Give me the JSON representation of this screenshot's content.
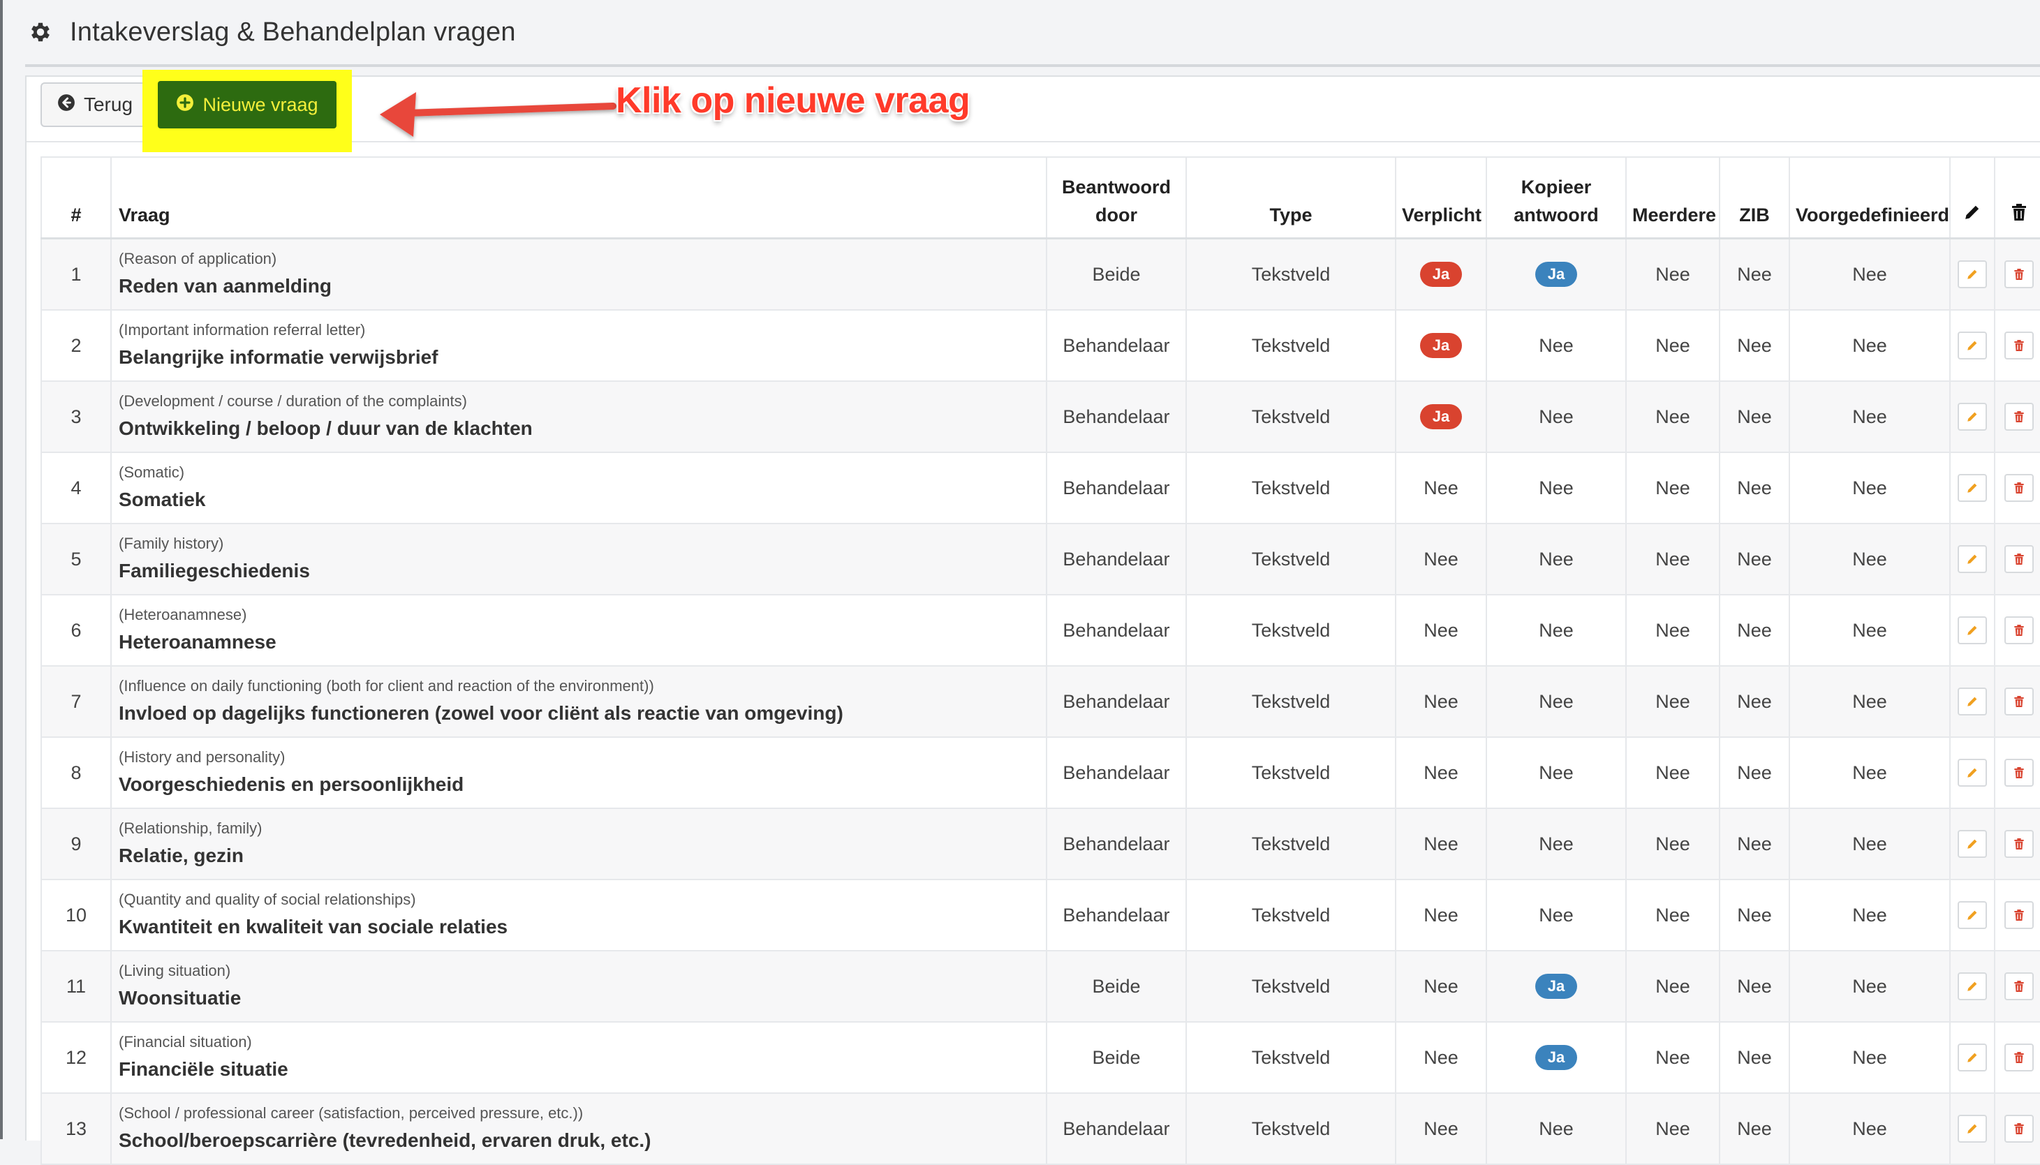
{
  "page": {
    "title": "Intakeverslag & Behandelplan vragen"
  },
  "toolbar": {
    "back_label": "Terug",
    "new_label": "Nieuwe vraag"
  },
  "annotation": {
    "text": "Klik op nieuwe vraag"
  },
  "table": {
    "headers": {
      "num": "#",
      "vraag": "Vraag",
      "beantwoord_line1": "Beantwoord",
      "beantwoord_line2": "door",
      "type": "Type",
      "verplicht": "Verplicht",
      "kopieer_line1": "Kopieer",
      "kopieer_line2": "antwoord",
      "meerdere": "Meerdere",
      "zib": "ZIB",
      "voorgedefinieerd": "Voorgedefinieerd"
    },
    "rows": [
      {
        "num": "1",
        "en": "(Reason of application)",
        "nl": "Reden van aanmelding",
        "door": "Beide",
        "type": "Tekstveld",
        "verplicht": "Ja",
        "kopieer": "Ja",
        "meerdere": "Nee",
        "zib": "Nee",
        "voor": "Nee"
      },
      {
        "num": "2",
        "en": "(Important information referral letter)",
        "nl": "Belangrijke informatie verwijsbrief",
        "door": "Behandelaar",
        "type": "Tekstveld",
        "verplicht": "Ja",
        "kopieer": "Nee",
        "meerdere": "Nee",
        "zib": "Nee",
        "voor": "Nee"
      },
      {
        "num": "3",
        "en": "(Development / course / duration of the complaints)",
        "nl": "Ontwikkeling / beloop / duur van de klachten",
        "door": "Behandelaar",
        "type": "Tekstveld",
        "verplicht": "Ja",
        "kopieer": "Nee",
        "meerdere": "Nee",
        "zib": "Nee",
        "voor": "Nee"
      },
      {
        "num": "4",
        "en": "(Somatic)",
        "nl": "Somatiek",
        "door": "Behandelaar",
        "type": "Tekstveld",
        "verplicht": "Nee",
        "kopieer": "Nee",
        "meerdere": "Nee",
        "zib": "Nee",
        "voor": "Nee"
      },
      {
        "num": "5",
        "en": "(Family history)",
        "nl": "Familiegeschiedenis",
        "door": "Behandelaar",
        "type": "Tekstveld",
        "verplicht": "Nee",
        "kopieer": "Nee",
        "meerdere": "Nee",
        "zib": "Nee",
        "voor": "Nee"
      },
      {
        "num": "6",
        "en": "(Heteroanamnese)",
        "nl": "Heteroanamnese",
        "door": "Behandelaar",
        "type": "Tekstveld",
        "verplicht": "Nee",
        "kopieer": "Nee",
        "meerdere": "Nee",
        "zib": "Nee",
        "voor": "Nee"
      },
      {
        "num": "7",
        "en": "(Influence on daily functioning (both for client and reaction of the environment))",
        "nl": "Invloed op dagelijks functioneren (zowel voor cliënt als reactie van omgeving)",
        "door": "Behandelaar",
        "type": "Tekstveld",
        "verplicht": "Nee",
        "kopieer": "Nee",
        "meerdere": "Nee",
        "zib": "Nee",
        "voor": "Nee"
      },
      {
        "num": "8",
        "en": "(History and personality)",
        "nl": "Voorgeschiedenis en persoonlijkheid",
        "door": "Behandelaar",
        "type": "Tekstveld",
        "verplicht": "Nee",
        "kopieer": "Nee",
        "meerdere": "Nee",
        "zib": "Nee",
        "voor": "Nee"
      },
      {
        "num": "9",
        "en": "(Relationship, family)",
        "nl": "Relatie, gezin",
        "door": "Behandelaar",
        "type": "Tekstveld",
        "verplicht": "Nee",
        "kopieer": "Nee",
        "meerdere": "Nee",
        "zib": "Nee",
        "voor": "Nee"
      },
      {
        "num": "10",
        "en": "(Quantity and quality of social relationships)",
        "nl": "Kwantiteit en kwaliteit van sociale relaties",
        "door": "Behandelaar",
        "type": "Tekstveld",
        "verplicht": "Nee",
        "kopieer": "Nee",
        "meerdere": "Nee",
        "zib": "Nee",
        "voor": "Nee"
      },
      {
        "num": "11",
        "en": "(Living situation)",
        "nl": "Woonsituatie",
        "door": "Beide",
        "type": "Tekstveld",
        "verplicht": "Nee",
        "kopieer": "Ja",
        "meerdere": "Nee",
        "zib": "Nee",
        "voor": "Nee"
      },
      {
        "num": "12",
        "en": "(Financial situation)",
        "nl": "Financiële situatie",
        "door": "Beide",
        "type": "Tekstveld",
        "verplicht": "Nee",
        "kopieer": "Ja",
        "meerdere": "Nee",
        "zib": "Nee",
        "voor": "Nee"
      },
      {
        "num": "13",
        "en": "(School / professional career (satisfaction, perceived pressure, etc.))",
        "nl": "School/beroepscarrière (tevredenheid, ervaren druk, etc.)",
        "door": "Behandelaar",
        "type": "Tekstveld",
        "verplicht": "Nee",
        "kopieer": "Nee",
        "meerdere": "Nee",
        "zib": "Nee",
        "voor": "Nee"
      }
    ]
  },
  "icons": {
    "header": "gear-icon",
    "back": "arrow-circle-left-icon",
    "new": "plus-circle-icon",
    "edit": "pencil-icon",
    "delete": "trash-icon"
  },
  "colors": {
    "verplicht_ja": "#d9432f",
    "kopieer_ja": "#3b83bd",
    "new_button": "#2d6b10",
    "new_button_text": "#f3ef3a",
    "highlight": "#ffff1a",
    "annotation": "#ff3a2a",
    "edit_icon": "#f0a020",
    "delete_icon": "#d9432f"
  }
}
